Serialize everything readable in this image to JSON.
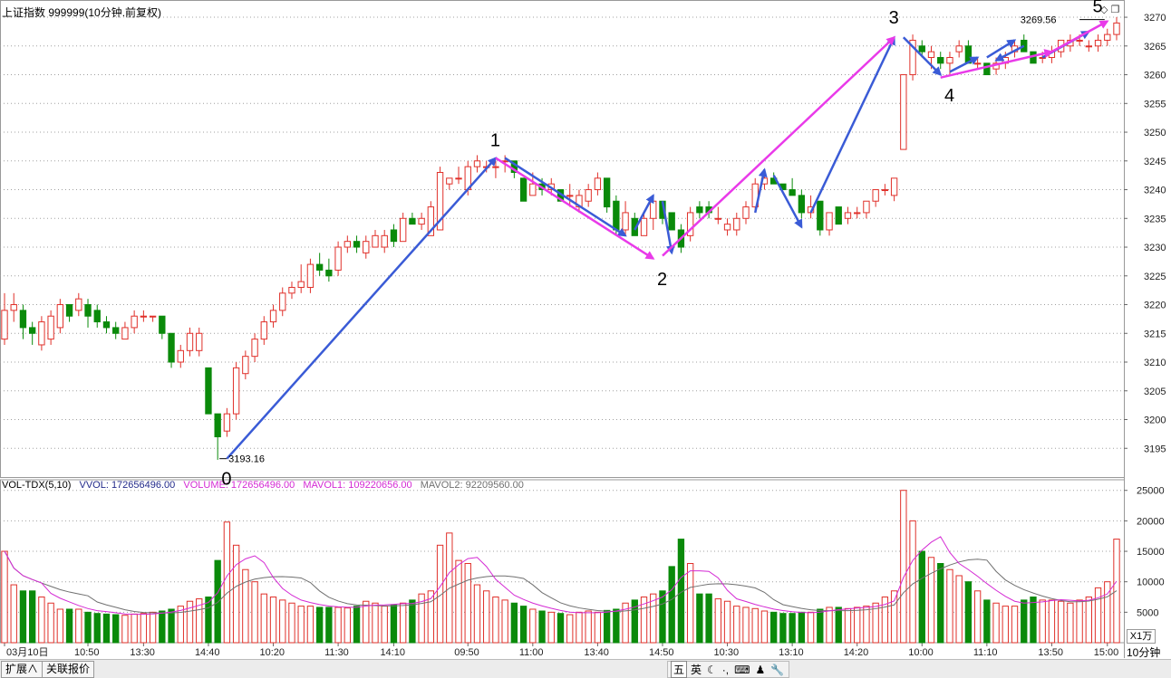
{
  "header": {
    "title": "上证指数 999999(10分钟.前复权)"
  },
  "volume_header": {
    "name": "VOL-TDX(5,10)",
    "vvol": "VVOL: 172656496.00",
    "volume": "VOLUME: 172656496.00",
    "mavol1": "MAVOL1: 109220656.00",
    "mavol2": "MAVOL2: 92209560.00"
  },
  "colors": {
    "up": "#e0302a",
    "down": "#0a8a0a",
    "grid": "#a0a0a0",
    "wave_blue": "#3a5bd6",
    "wave_magenta": "#e93ae9",
    "mavol1": "#d42ad4",
    "mavol2": "#707070"
  },
  "icons": {
    "diamond": "diamond-icon",
    "restore": "restore-icon"
  },
  "price_axis": {
    "min": 3190,
    "max": 3273,
    "ticks": [
      3270,
      3265,
      3260,
      3255,
      3250,
      3245,
      3240,
      3235,
      3230,
      3225,
      3220,
      3215,
      3210,
      3205,
      3200,
      3195
    ]
  },
  "vol_axis": {
    "min": 0,
    "max": 26000,
    "ticks": [
      25000,
      20000,
      15000,
      10000,
      5000
    ],
    "unit": "X1万"
  },
  "time_labels": [
    {
      "i": 0,
      "t": "03月10日"
    },
    {
      "i": 9,
      "t": "10:50"
    },
    {
      "i": 15,
      "t": "13:30"
    },
    {
      "i": 22,
      "t": "14:40"
    },
    {
      "i": 29,
      "t": "10:20"
    },
    {
      "i": 36,
      "t": "11:30"
    },
    {
      "i": 42,
      "t": "14:10"
    },
    {
      "i": 50,
      "t": "09:50"
    },
    {
      "i": 57,
      "t": "11:00"
    },
    {
      "i": 64,
      "t": "13:40"
    },
    {
      "i": 71,
      "t": "14:50"
    },
    {
      "i": 78,
      "t": "10:30"
    },
    {
      "i": 85,
      "t": "13:10"
    },
    {
      "i": 92,
      "t": "14:20"
    },
    {
      "i": 99,
      "t": "10:00"
    },
    {
      "i": 106,
      "t": "11:10"
    },
    {
      "i": 113,
      "t": "13:50"
    },
    {
      "i": 119,
      "t": "15:00"
    }
  ],
  "period_label": "10分钟",
  "chart_data": {
    "type": "candlestick",
    "ohlc": [
      [
        3214,
        3222,
        3213,
        3219
      ],
      [
        3219,
        3222,
        3217,
        3220
      ],
      [
        3219,
        3220,
        3214,
        3216
      ],
      [
        3216,
        3217,
        3213,
        3215
      ],
      [
        3213,
        3218,
        3212,
        3217
      ],
      [
        3214,
        3219,
        3213,
        3218
      ],
      [
        3216,
        3221,
        3215,
        3220
      ],
      [
        3220,
        3220,
        3217,
        3218
      ],
      [
        3219,
        3222,
        3218,
        3221
      ],
      [
        3220,
        3221,
        3216,
        3218
      ],
      [
        3219,
        3220,
        3216,
        3217
      ],
      [
        3217,
        3218,
        3215,
        3216
      ],
      [
        3216,
        3217,
        3214,
        3215
      ],
      [
        3214,
        3217,
        3214,
        3216
      ],
      [
        3216,
        3219,
        3215,
        3218
      ],
      [
        3218,
        3219,
        3217,
        3218
      ],
      [
        3218,
        3218,
        3217,
        3218
      ],
      [
        3218,
        3218,
        3214,
        3215
      ],
      [
        3215,
        3215,
        3209,
        3210
      ],
      [
        3210,
        3213,
        3209,
        3212
      ],
      [
        3212,
        3216,
        3211,
        3215
      ],
      [
        3212,
        3216,
        3211,
        3215
      ],
      [
        3209,
        3209,
        3201,
        3201
      ],
      [
        3201,
        3201,
        3193,
        3197
      ],
      [
        3198,
        3202,
        3197,
        3201
      ],
      [
        3201,
        3210,
        3200,
        3209
      ],
      [
        3208,
        3212,
        3207,
        3211
      ],
      [
        3211,
        3215,
        3210,
        3214
      ],
      [
        3214,
        3218,
        3213,
        3217
      ],
      [
        3217,
        3220,
        3216,
        3219
      ],
      [
        3219,
        3223,
        3218,
        3222
      ],
      [
        3222,
        3224,
        3221,
        3223
      ],
      [
        3223,
        3227,
        3222,
        3224
      ],
      [
        3223,
        3228,
        3222,
        3227
      ],
      [
        3227,
        3229,
        3225,
        3226
      ],
      [
        3226,
        3228,
        3224,
        3225
      ],
      [
        3226,
        3231,
        3225,
        3230
      ],
      [
        3230,
        3232,
        3229,
        3231
      ],
      [
        3231,
        3232,
        3229,
        3230
      ],
      [
        3229,
        3232,
        3228,
        3231
      ],
      [
        3230,
        3233,
        3230,
        3232
      ],
      [
        3230,
        3233,
        3229,
        3232
      ],
      [
        3233,
        3234,
        3230,
        3231
      ],
      [
        3231,
        3236,
        3231,
        3235
      ],
      [
        3235,
        3236,
        3234,
        3234
      ],
      [
        3234,
        3236,
        3233,
        3235
      ],
      [
        3232,
        3238,
        3232,
        3237
      ],
      [
        3233,
        3244,
        3233,
        3243
      ],
      [
        3241,
        3242,
        3240,
        3242
      ],
      [
        3242,
        3244,
        3241,
        3242
      ],
      [
        3240,
        3245,
        3239,
        3244
      ],
      [
        3244,
        3246,
        3243,
        3245
      ],
      [
        3244,
        3245,
        3243,
        3244
      ],
      [
        3244,
        3245,
        3242,
        3244
      ],
      [
        3245,
        3246,
        3243,
        3245
      ],
      [
        3245,
        3245,
        3242,
        3243
      ],
      [
        3242,
        3242,
        3238,
        3238
      ],
      [
        3239,
        3243,
        3239,
        3241
      ],
      [
        3241,
        3242,
        3239,
        3240
      ],
      [
        3240,
        3242,
        3239,
        3241
      ],
      [
        3240,
        3240,
        3238,
        3238
      ],
      [
        3239,
        3241,
        3237,
        3239
      ],
      [
        3237,
        3240,
        3236,
        3239
      ],
      [
        3238,
        3241,
        3237,
        3240
      ],
      [
        3240,
        3243,
        3239,
        3242
      ],
      [
        3242,
        3242,
        3236,
        3237
      ],
      [
        3238,
        3239,
        3232,
        3233
      ],
      [
        3233,
        3238,
        3232,
        3236
      ],
      [
        3235,
        3236,
        3232,
        3232
      ],
      [
        3232,
        3236,
        3232,
        3235
      ],
      [
        3235,
        3239,
        3233,
        3238
      ],
      [
        3238,
        3238,
        3234,
        3235
      ],
      [
        3236,
        3236,
        3233,
        3233
      ],
      [
        3233,
        3234,
        3229,
        3230
      ],
      [
        3232,
        3237,
        3231,
        3236
      ],
      [
        3237,
        3238,
        3235,
        3236
      ],
      [
        3237,
        3238,
        3235,
        3236
      ],
      [
        3235,
        3237,
        3234,
        3235
      ],
      [
        3233,
        3235,
        3232,
        3234
      ],
      [
        3233,
        3236,
        3232,
        3235
      ],
      [
        3235,
        3238,
        3234,
        3237
      ],
      [
        3237,
        3242,
        3236,
        3241
      ],
      [
        3241,
        3243,
        3240,
        3242
      ],
      [
        3242,
        3243,
        3241,
        3241
      ],
      [
        3241,
        3241,
        3240,
        3240
      ],
      [
        3240,
        3242,
        3239,
        3239
      ],
      [
        3239,
        3240,
        3235,
        3236
      ],
      [
        3236,
        3239,
        3235,
        3237
      ],
      [
        3238,
        3238,
        3232,
        3233
      ],
      [
        3233,
        3236,
        3232,
        3236
      ],
      [
        3237,
        3237,
        3234,
        3234
      ],
      [
        3235,
        3237,
        3234,
        3236
      ],
      [
        3236,
        3237,
        3235,
        3236
      ],
      [
        3236,
        3238,
        3235,
        3238
      ],
      [
        3238,
        3240,
        3237,
        3240
      ],
      [
        3240,
        3241,
        3239,
        3240
      ],
      [
        3239,
        3242,
        3238,
        3242
      ],
      [
        3247,
        3260,
        3247,
        3260
      ],
      [
        3260,
        3267,
        3259,
        3266
      ],
      [
        3265,
        3266,
        3263,
        3264
      ],
      [
        3263,
        3265,
        3261,
        3264
      ],
      [
        3263,
        3264,
        3261,
        3262
      ],
      [
        3262,
        3264,
        3260,
        3263
      ],
      [
        3264,
        3266,
        3263,
        3265
      ],
      [
        3265,
        3266,
        3262,
        3262
      ],
      [
        3262,
        3263,
        3261,
        3262
      ],
      [
        3262,
        3262,
        3260,
        3260
      ],
      [
        3261,
        3263,
        3260,
        3262
      ],
      [
        3262,
        3264,
        3261,
        3263
      ],
      [
        3264,
        3266,
        3263,
        3265
      ],
      [
        3266,
        3267,
        3264,
        3264
      ],
      [
        3264,
        3264,
        3262,
        3262
      ],
      [
        3263,
        3264,
        3262,
        3263
      ],
      [
        3263,
        3265,
        3262,
        3264
      ],
      [
        3264,
        3266,
        3263,
        3266
      ],
      [
        3265,
        3267,
        3264,
        3266
      ],
      [
        3266,
        3267,
        3265,
        3266
      ],
      [
        3265,
        3266,
        3264,
        3265
      ],
      [
        3265,
        3267,
        3264,
        3266
      ],
      [
        3266,
        3268,
        3265,
        3267
      ],
      [
        3267,
        3270,
        3266,
        3269
      ]
    ],
    "volume": [
      15000,
      9500,
      8500,
      8500,
      7500,
      6500,
      5500,
      5500,
      5500,
      5000,
      4800,
      4700,
      4600,
      4500,
      4700,
      4800,
      5000,
      5200,
      5500,
      6000,
      6800,
      7200,
      7500,
      13500,
      19800,
      16000,
      12000,
      10000,
      8000,
      7500,
      7000,
      6500,
      6000,
      6000,
      5800,
      5800,
      5800,
      5700,
      6000,
      6800,
      6500,
      6000,
      6200,
      6500,
      7000,
      8000,
      8500,
      16000,
      18000,
      13500,
      13000,
      9500,
      8500,
      7500,
      7000,
      6500,
      6000,
      5500,
      5200,
      5000,
      4800,
      4600,
      5000,
      5200,
      5000,
      5300,
      5500,
      6500,
      7000,
      7500,
      8000,
      8500,
      12500,
      17000,
      13000,
      8000,
      8000,
      7200,
      6800,
      6000,
      5800,
      5600,
      5200,
      5000,
      4800,
      4800,
      5000,
      5000,
      5500,
      5800,
      5800,
      5600,
      5800,
      6000,
      6500,
      7500,
      8500,
      25000,
      20000,
      15000,
      14000,
      13000,
      12000,
      11000,
      10000,
      8500,
      7000,
      6500,
      6000,
      6000,
      7000,
      7500,
      7000,
      7000,
      6800,
      6500,
      7000,
      7500,
      9000,
      10000,
      17000
    ],
    "annotations": [
      "3193.16",
      "3269.56"
    ],
    "wave_labels": [
      "0",
      "1",
      "2",
      "3",
      "4",
      "5"
    ]
  }
}
